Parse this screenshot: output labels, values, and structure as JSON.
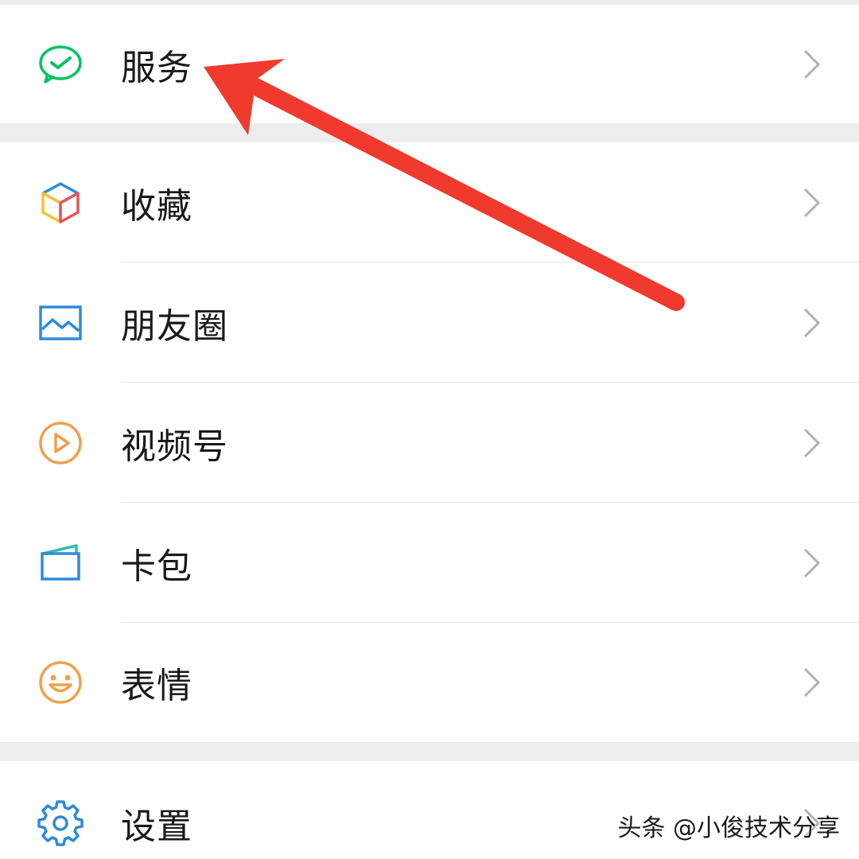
{
  "menu": {
    "services": {
      "label": "服务",
      "icon": "wechat-pay-check-icon"
    },
    "favorites": {
      "label": "收藏",
      "icon": "cube-icon"
    },
    "moments": {
      "label": "朋友圈",
      "icon": "picture-icon"
    },
    "channels": {
      "label": "视频号",
      "icon": "play-circle-icon"
    },
    "cards": {
      "label": "卡包",
      "icon": "wallet-icon"
    },
    "stickers": {
      "label": "表情",
      "icon": "smiley-icon"
    },
    "settings": {
      "label": "设置",
      "icon": "gear-icon"
    }
  },
  "colors": {
    "background": "#ededed",
    "surface": "#ffffff",
    "text": "#191919",
    "chevron": "#b2b2b2",
    "wechat_green": "#07c160",
    "blue": "#2e8bd8",
    "orange": "#f0a04b",
    "annotation_red": "#f03a2e"
  },
  "watermark": {
    "text": "头条 @小俊技术分享"
  }
}
